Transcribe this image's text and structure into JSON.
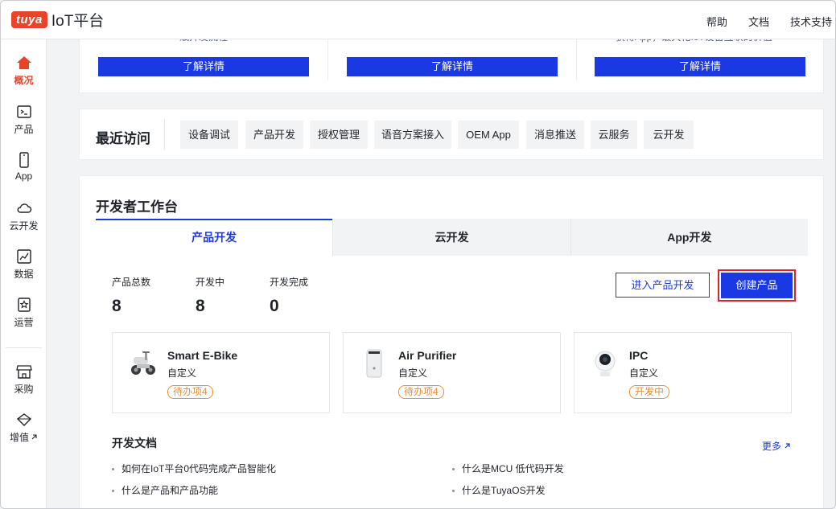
{
  "header": {
    "logo_badge": "tuya",
    "logo_text": "IoT平台",
    "links": [
      "帮助",
      "文档",
      "技术支持"
    ]
  },
  "sidebar": {
    "items": [
      {
        "label": "概况",
        "icon": "home-icon",
        "active": true
      },
      {
        "label": "产品",
        "icon": "terminal-icon"
      },
      {
        "label": "App",
        "icon": "phone-icon"
      },
      {
        "label": "云开发",
        "icon": "cloud-icon"
      },
      {
        "label": "数据",
        "icon": "chart-icon"
      },
      {
        "label": "运营",
        "icon": "star-badge-icon"
      },
      {
        "label": "采购",
        "icon": "shop-icon"
      },
      {
        "label": "增值",
        "icon": "gem-icon",
        "external": true
      }
    ]
  },
  "intro_cards": {
    "cut_texts": [
      "赋开发流程",
      "",
      "获得App，最大化IoT设备互联的价值"
    ],
    "button_label": "了解详情"
  },
  "recent": {
    "title": "最近访问",
    "items": [
      "设备调试",
      "产品开发",
      "授权管理",
      "语音方案接入",
      "OEM App",
      "消息推送",
      "云服务",
      "云开发"
    ]
  },
  "workspace": {
    "title": "开发者工作台",
    "tabs": [
      {
        "label": "产品开发",
        "active": true
      },
      {
        "label": "云开发"
      },
      {
        "label": "App开发"
      }
    ],
    "stats": [
      {
        "label": "产品总数",
        "value": "8"
      },
      {
        "label": "开发中",
        "value": "8"
      },
      {
        "label": "开发完成",
        "value": "0"
      }
    ],
    "enter_button": "进入产品开发",
    "create_button": "创建产品",
    "products": [
      {
        "name": "Smart E-Bike",
        "type": "自定义",
        "tag": "待办项4",
        "icon": "ebike-icon"
      },
      {
        "name": "Air Purifier",
        "type": "自定义",
        "tag": "待办项4",
        "icon": "air-purifier-icon"
      },
      {
        "name": "IPC",
        "type": "自定义",
        "tag": "开发中",
        "icon": "camera-icon"
      }
    ],
    "docs_title": "开发文档",
    "more_label": "更多",
    "docs": [
      "如何在IoT平台0代码完成产品智能化",
      "什么是MCU 低代码开发",
      "什么是产品和产品功能",
      "什么是TuyaOS开发"
    ]
  },
  "colors": {
    "brand": "#e8442a",
    "primary": "#1a38e3",
    "warning": "#f08c2f",
    "highlight_border": "#e0202f"
  }
}
